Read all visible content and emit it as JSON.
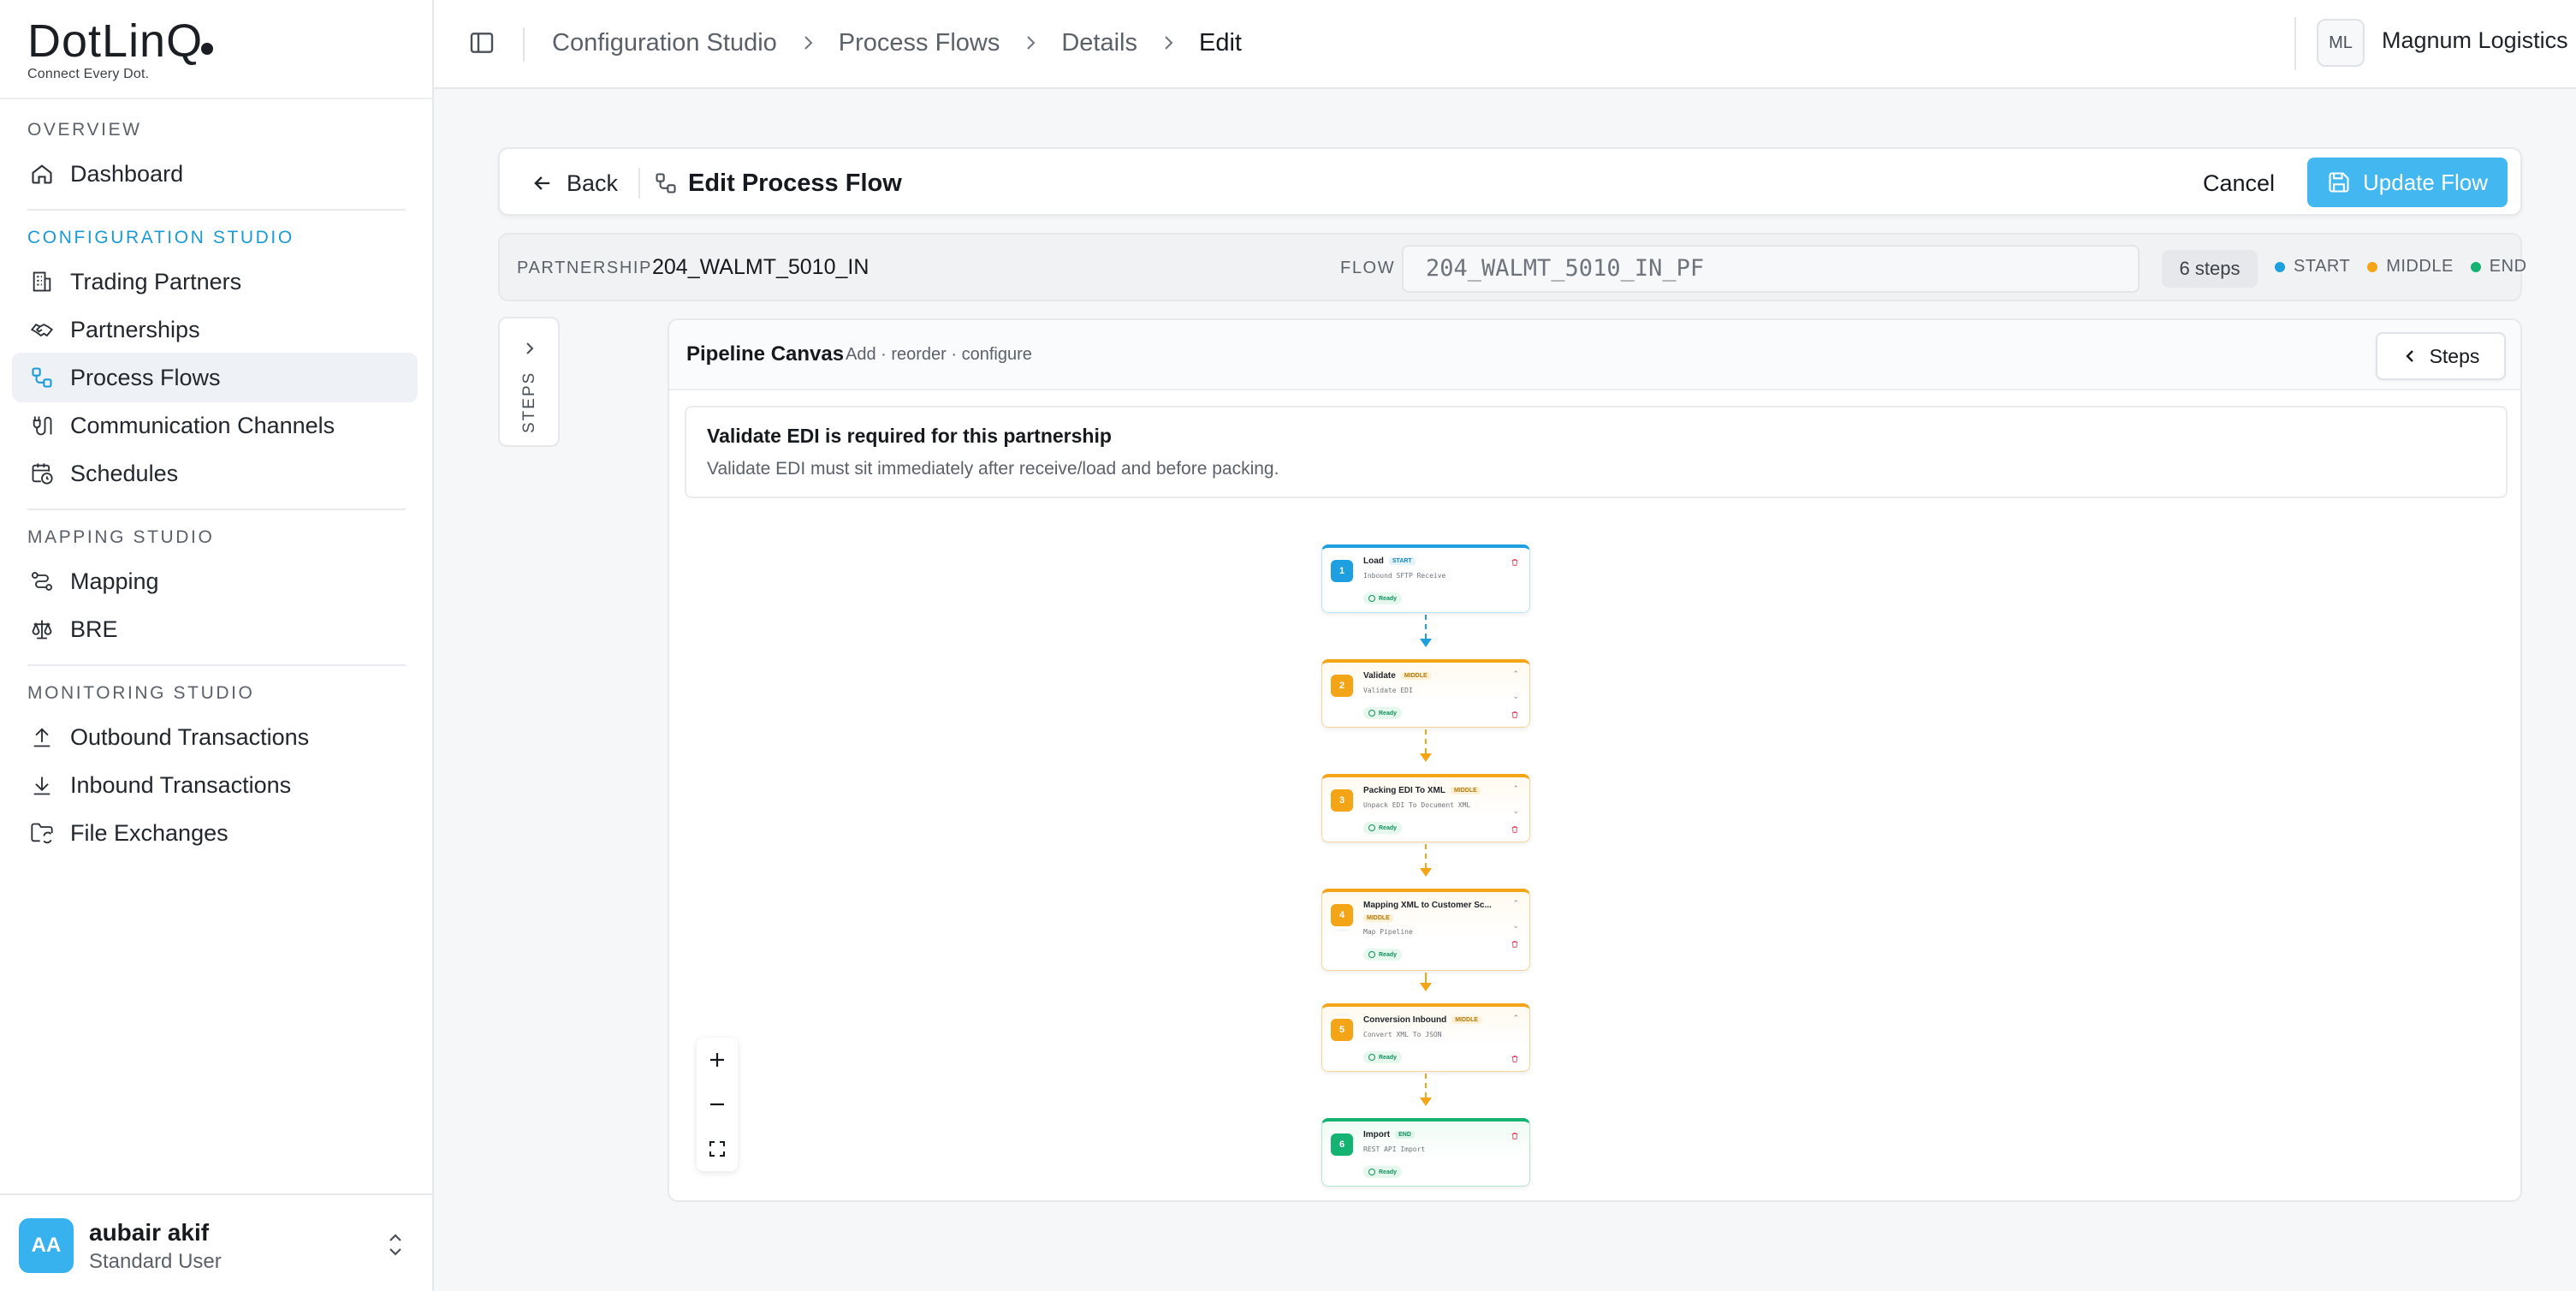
{
  "brand": {
    "name": "DotLinQ",
    "tagline": "Connect Every Dot."
  },
  "sidebar": {
    "overview_label": "OVERVIEW",
    "dashboard": "Dashboard",
    "config_label": "CONFIGURATION STUDIO",
    "config_items": [
      "Trading Partners",
      "Partnerships",
      "Process Flows",
      "Communication Channels",
      "Schedules"
    ],
    "mapping_label": "MAPPING STUDIO",
    "mapping_items": [
      "Mapping",
      "BRE"
    ],
    "monitoring_label": "MONITORING STUDIO",
    "monitoring_items": [
      "Outbound Transactions",
      "Inbound Transactions",
      "File Exchanges"
    ],
    "active_item": "Process Flows"
  },
  "user": {
    "initials": "AA",
    "name": "aubair akif",
    "role": "Standard User"
  },
  "topbar": {
    "breadcrumbs": [
      "Configuration Studio",
      "Process Flows",
      "Details",
      "Edit"
    ],
    "org_initials": "ML",
    "org_name": "Magnum Logistics"
  },
  "header": {
    "back_label": "Back",
    "title": "Edit Process Flow",
    "cancel_label": "Cancel",
    "update_label": "Update Flow"
  },
  "info": {
    "partnership_label": "PARTNERSHIP",
    "partnership_value": "204_WALMT_5010_IN",
    "flow_label": "FLOW",
    "flow_value": "204_WALMT_5010_IN_PF",
    "steps_count": "6 steps",
    "legend": [
      {
        "label": "START",
        "color": "#1d9fe0"
      },
      {
        "label": "MIDDLE",
        "color": "#f3a417"
      },
      {
        "label": "END",
        "color": "#15b371"
      }
    ]
  },
  "steps_rail": {
    "label": "STEPS"
  },
  "canvas": {
    "title": "Pipeline Canvas",
    "subtitle": "Add · reorder · configure",
    "steps_button": "Steps",
    "alert_title": "Validate EDI is required for this partnership",
    "alert_body": "Validate EDI must sit immediately after receive/load and before packing."
  },
  "nodes": [
    {
      "num": "1",
      "title": "Load",
      "badge": "START",
      "kind": "start",
      "sub": "Inbound SFTP Receive",
      "status": "Ready"
    },
    {
      "num": "2",
      "title": "Validate",
      "badge": "MIDDLE",
      "kind": "middle",
      "sub": "Validate EDI",
      "status": "Ready"
    },
    {
      "num": "3",
      "title": "Packing EDI To XML",
      "badge": "MIDDLE",
      "kind": "middle",
      "sub": "Unpack EDI To Document XML",
      "status": "Ready"
    },
    {
      "num": "4",
      "title": "Mapping XML to Customer Sc...",
      "badge": "MIDDLE",
      "kind": "middle",
      "sub": "Map Pipeline",
      "status": "Ready"
    },
    {
      "num": "5",
      "title": "Conversion Inbound",
      "badge": "MIDDLE",
      "kind": "middle",
      "sub": "Convert XML To JSON",
      "status": "Ready"
    },
    {
      "num": "6",
      "title": "Import",
      "badge": "END",
      "kind": "end",
      "sub": "REST API Import",
      "status": "Ready"
    }
  ],
  "colors": {
    "accent": "#42b7f0",
    "start": "#1d9fe0",
    "middle": "#f3a417",
    "end": "#15b371"
  }
}
